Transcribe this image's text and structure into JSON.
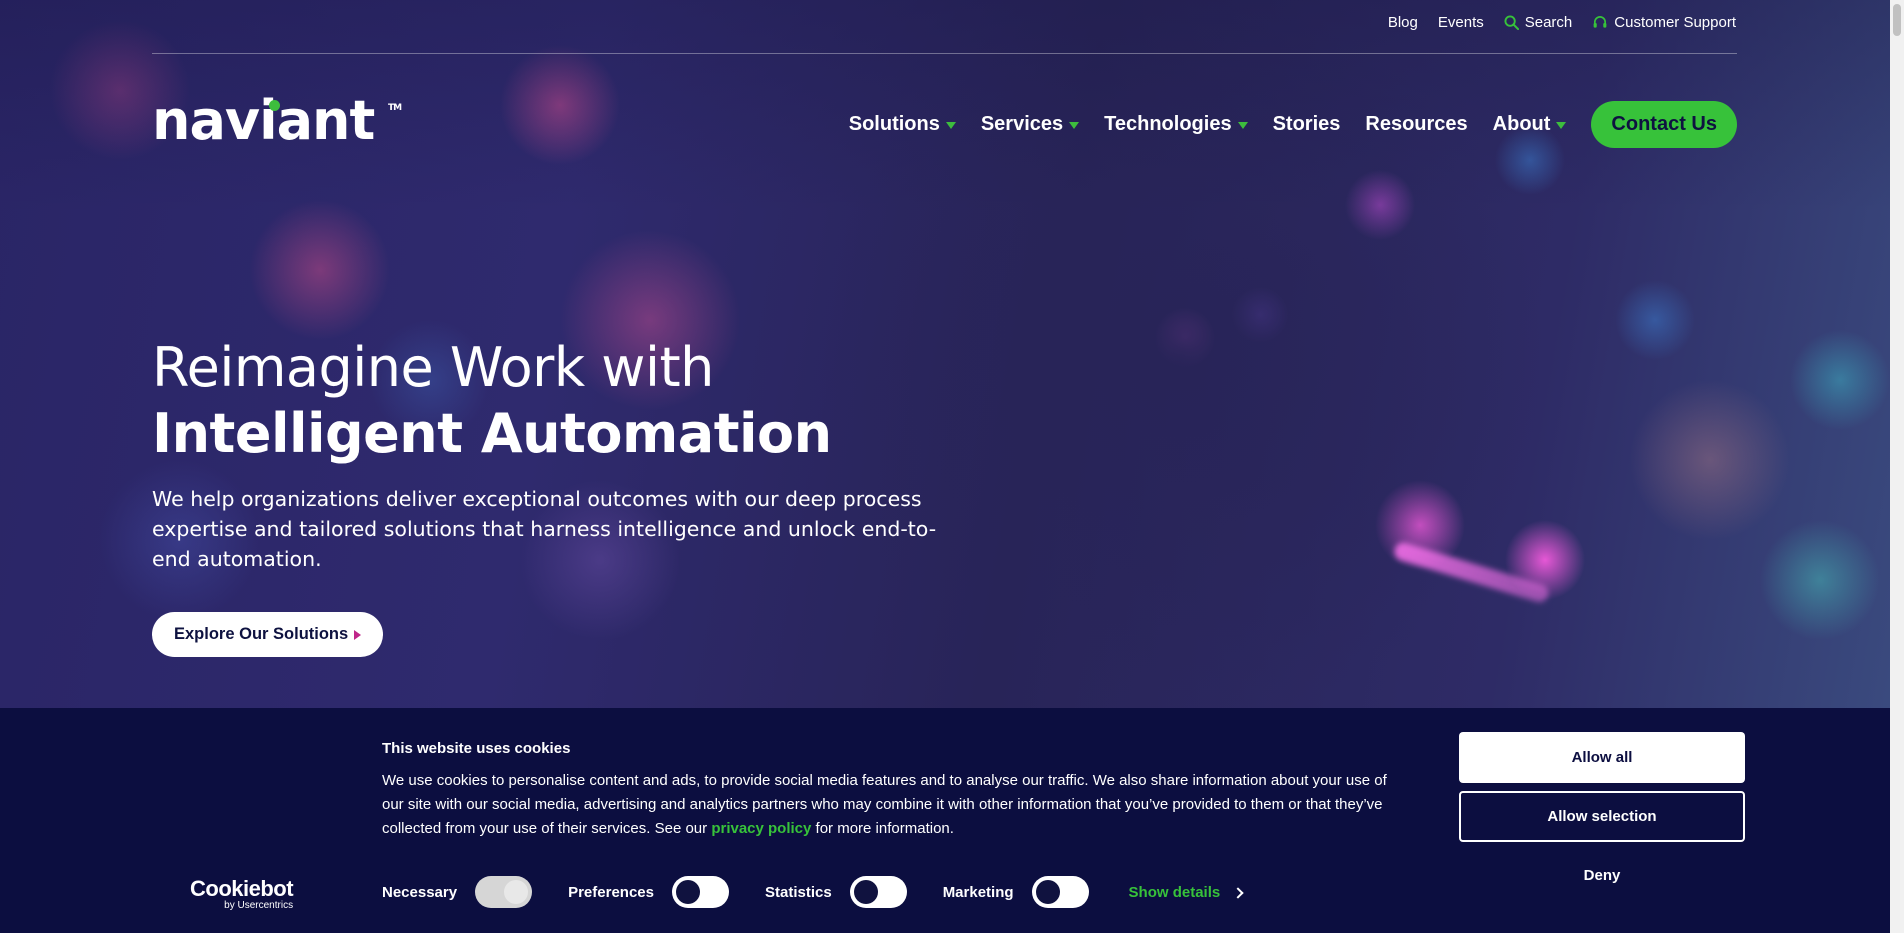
{
  "utility_nav": {
    "blog": "Blog",
    "events": "Events",
    "search": "Search",
    "support": "Customer Support"
  },
  "logo": {
    "text": "naviant",
    "tm": "TM"
  },
  "main_nav": {
    "items": [
      {
        "label": "Solutions",
        "has_dropdown": true
      },
      {
        "label": "Services",
        "has_dropdown": true
      },
      {
        "label": "Technologies",
        "has_dropdown": true
      },
      {
        "label": "Stories",
        "has_dropdown": false
      },
      {
        "label": "Resources",
        "has_dropdown": false
      },
      {
        "label": "About",
        "has_dropdown": true
      }
    ],
    "cta": "Contact Us"
  },
  "hero": {
    "title_line1": "Reimagine Work with",
    "title_line2": "Intelligent Automation",
    "subtitle": "We help organizations deliver exceptional outcomes with our deep process expertise and tailored solutions that harness intelligence and unlock end-to-end automation.",
    "cta": "Explore Our Solutions"
  },
  "cookie_banner": {
    "title": "This website uses cookies",
    "text_before_link": "We use cookies to personalise content and ads, to provide social media features and to analyse our traffic. We also share information about your use of our site with our social media, advertising and analytics partners who may combine it with other information that you’ve provided to them or that they’ve collected from your use of their services. See our ",
    "link": "privacy policy",
    "text_after_link": " for more information.",
    "brand": "Cookiebot",
    "brand_sub": "by Usercentrics",
    "toggles": [
      {
        "label": "Necessary",
        "on": true
      },
      {
        "label": "Preferences",
        "on": false
      },
      {
        "label": "Statistics",
        "on": false
      },
      {
        "label": "Marketing",
        "on": false
      }
    ],
    "show_details": "Show details",
    "buttons": {
      "allow_all": "Allow all",
      "allow_selection": "Allow selection",
      "deny": "Deny"
    }
  },
  "colors": {
    "accent_green": "#37c23a",
    "banner_bg": "#0c0e40",
    "hero_bg": "#2a2566",
    "explore_arrow": "#c0268a"
  }
}
